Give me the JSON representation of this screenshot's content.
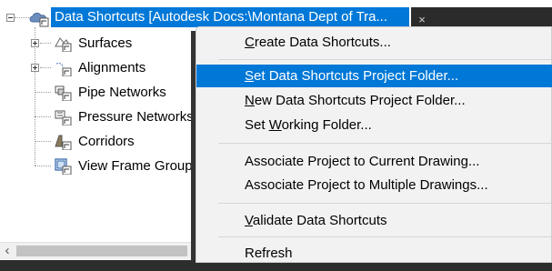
{
  "tree": {
    "root_label": "Data Shortcuts [Autodesk Docs:\\Montana Dept of Tra...",
    "close_glyph": "×",
    "items": [
      {
        "label": "Surfaces",
        "icon": "surfaces-icon",
        "expandable": true
      },
      {
        "label": "Alignments",
        "icon": "alignments-icon",
        "expandable": true
      },
      {
        "label": "Pipe Networks",
        "icon": "pipe-networks-icon",
        "expandable": false
      },
      {
        "label": "Pressure Networks",
        "icon": "pressure-networks-icon",
        "expandable": false
      },
      {
        "label": "Corridors",
        "icon": "corridors-icon",
        "expandable": false
      },
      {
        "label": "View Frame Groups",
        "icon": "view-frame-groups-icon",
        "expandable": false
      }
    ],
    "scroll_left_glyph": "‹"
  },
  "menu": {
    "items": [
      {
        "pre": "",
        "mn": "C",
        "post": "reate Data Shortcuts..."
      },
      {
        "pre": "",
        "mn": "S",
        "post": "et Data Shortcuts Project Folder...",
        "highlighted": true
      },
      {
        "pre": "",
        "mn": "N",
        "post": "ew Data Shortcuts Project Folder..."
      },
      {
        "pre": "Set ",
        "mn": "W",
        "post": "orking Folder..."
      },
      {
        "pre": "Associate Project to Current Drawing...",
        "mn": "",
        "post": ""
      },
      {
        "pre": "Associate Project to Multiple Drawings...",
        "mn": "",
        "post": ""
      },
      {
        "pre": "",
        "mn": "V",
        "post": "alidate Data Shortcuts"
      },
      {
        "pre": "Refresh",
        "mn": "",
        "post": ""
      }
    ]
  },
  "colors": {
    "selection": "#0078d7",
    "menu_bg": "#f2f2f2",
    "dark": "#2b2b2b"
  }
}
